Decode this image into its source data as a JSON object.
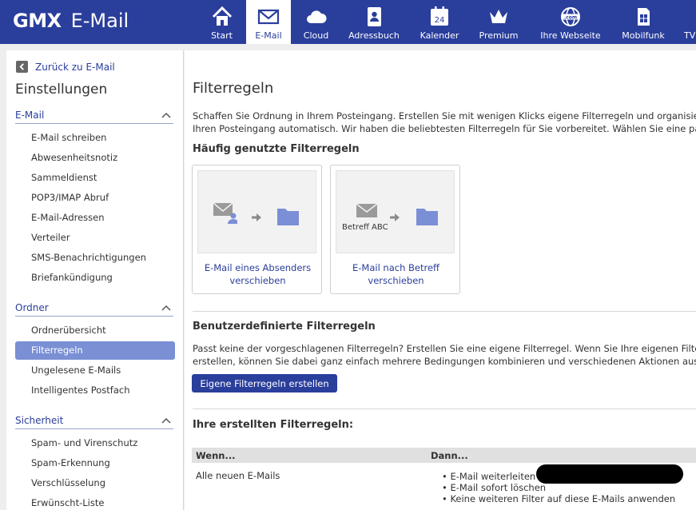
{
  "brand": {
    "logo": "GMX",
    "product": "E-Mail"
  },
  "nav": [
    {
      "label": "Start",
      "icon": "home-icon",
      "active": false
    },
    {
      "label": "E-Mail",
      "icon": "envelope-icon",
      "active": true
    },
    {
      "label": "Cloud",
      "icon": "cloud-icon",
      "active": false
    },
    {
      "label": "Adressbuch",
      "icon": "addressbook-icon",
      "active": false
    },
    {
      "label": "Kalender",
      "icon": "calendar-icon",
      "active": false,
      "day": "24"
    },
    {
      "label": "Premium",
      "icon": "crown-icon",
      "active": false
    },
    {
      "label": "Ihre Webseite",
      "icon": "globe-icon",
      "active": false,
      "badge": ".com"
    },
    {
      "label": "Mobilfunk",
      "icon": "simcard-icon",
      "active": false
    },
    {
      "label": "TV",
      "icon": "tv-icon",
      "active": false
    }
  ],
  "sidebar": {
    "back_label": "Zurück zu E-Mail",
    "title": "Einstellungen",
    "sections": [
      {
        "title": "E-Mail",
        "items": [
          "E-Mail schreiben",
          "Abwesenheitsnotiz",
          "Sammeldienst",
          "POP3/IMAP Abruf",
          "E-Mail-Adressen",
          "Verteiler",
          "SMS-Benachrichtigungen",
          "Briefankündigung"
        ]
      },
      {
        "title": "Ordner",
        "items": [
          "Ordnerübersicht",
          "Filterregeln",
          "Ungelesene E-Mails",
          "Intelligentes Postfach"
        ]
      },
      {
        "title": "Sicherheit",
        "items": [
          "Spam- und Virenschutz",
          "Spam-Erkennung",
          "Verschlüsselung",
          "Erwünscht-Liste"
        ]
      }
    ],
    "active_item": "Filterregeln"
  },
  "main": {
    "title": "Filterregeln",
    "intro_line1": "Schaffen Sie Ordnung in Ihrem Posteingang. Erstellen Sie mit wenigen Klicks eigene Filterregeln und organisie",
    "intro_line2": "Ihren Posteingang automatisch. Wir haben die beliebtesten Filterregeln für Sie vorbereitet. Wählen Sie eine pa",
    "common_heading": "Häufig genutzte Filterregeln",
    "cards": [
      {
        "label": "E-Mail eines Absenders\nverschieben",
        "image_caption": ""
      },
      {
        "label": "E-Mail nach Betreff\nverschieben",
        "image_caption": "Betreff ABC"
      }
    ],
    "custom_heading": "Benutzerdefinierte Filterregeln",
    "custom_line1": "Passt keine der vorgeschlagenen Filterregeln? Erstellen Sie eine eigene Filterregel. Wenn Sie Ihre eigenen Filte",
    "custom_line2": "erstellen, können Sie dabei ganz einfach mehrere Bedingungen kombinieren und verschiedenen Aktionen ausf",
    "create_button": "Eigene Filterregeln erstellen",
    "created_heading": "Ihre erstellten Filterregeln:",
    "table": {
      "col_when": "Wenn...",
      "col_then": "Dann...",
      "rows": [
        {
          "when": "Alle neuen E-Mails",
          "then": [
            "• E-Mail weiterleiten an",
            "• E-Mail sofort löschen",
            "• Keine weiteren Filter auf diese E-Mails anwenden"
          ]
        }
      ]
    }
  },
  "colors": {
    "brand": "#2a3e9c",
    "active_item": "#7a8fd4",
    "icon": "#7b8fd6"
  }
}
